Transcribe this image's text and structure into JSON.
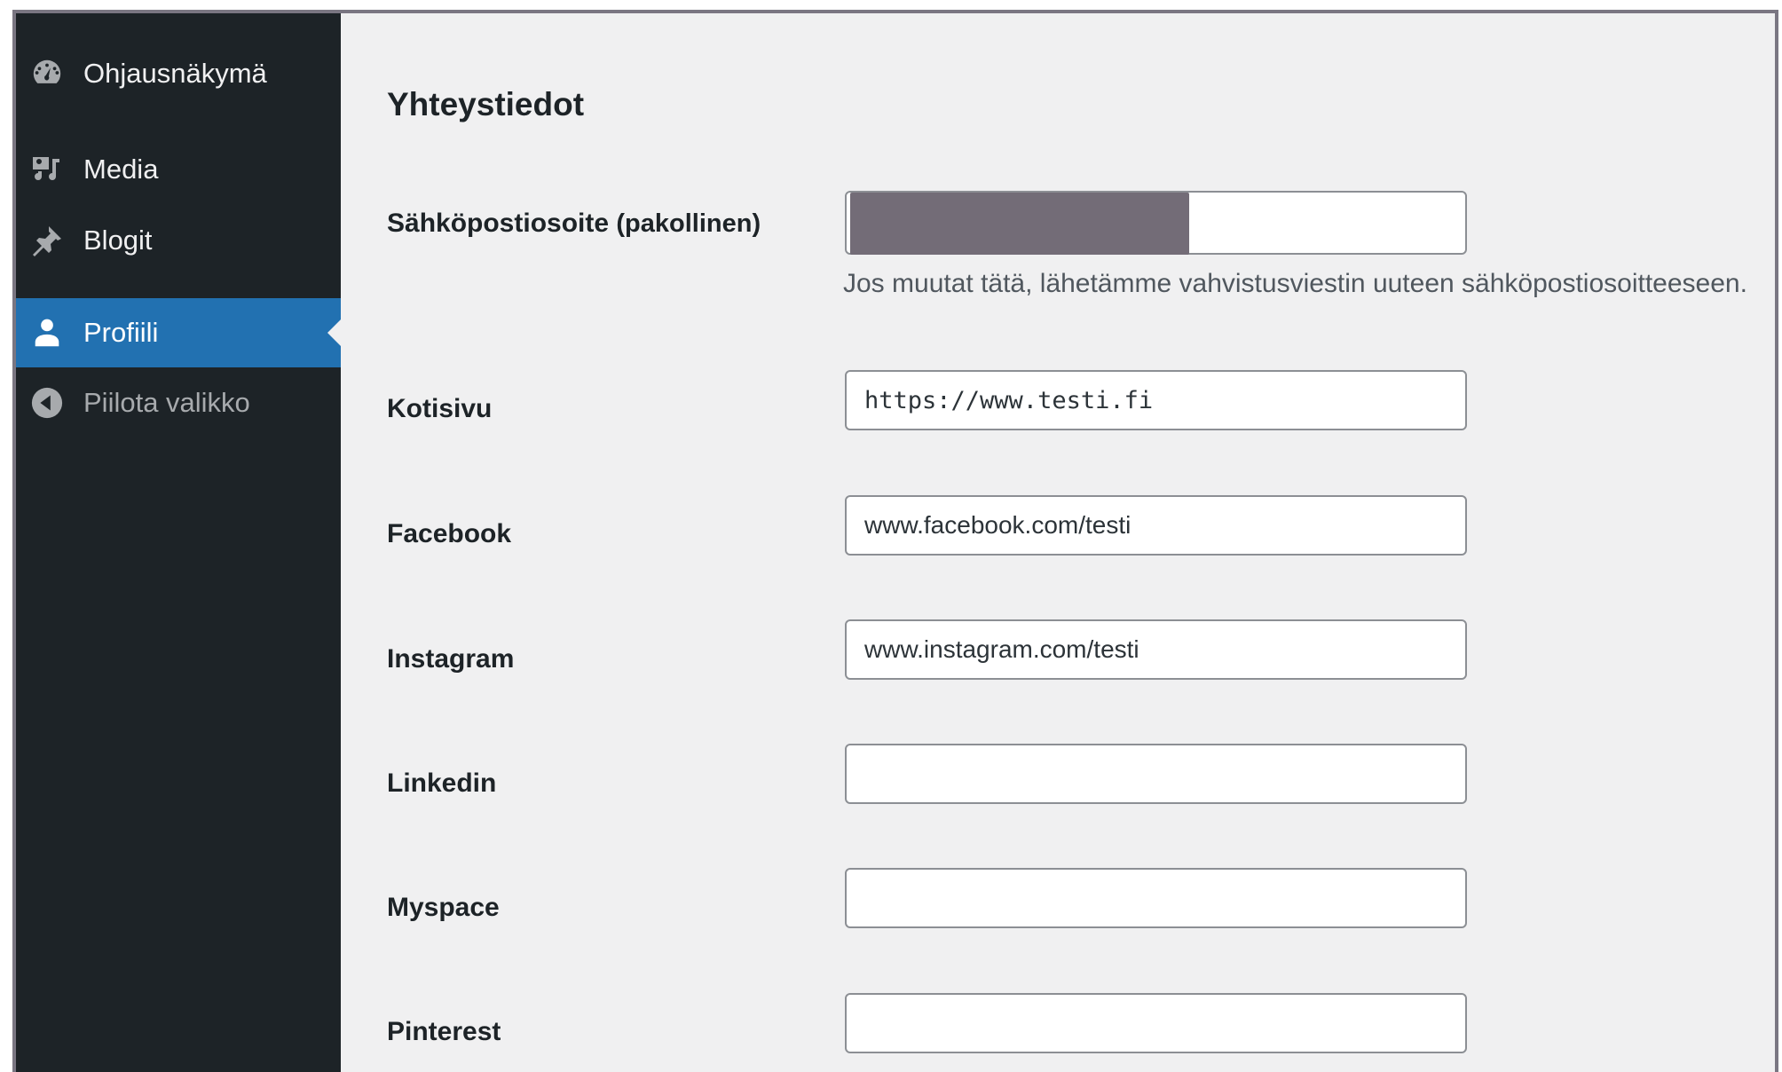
{
  "sidebar": {
    "items": [
      {
        "label": "Ohjausnäkymä",
        "icon": "dashboard-icon"
      },
      {
        "label": "Media",
        "icon": "media-icon"
      },
      {
        "label": "Blogit",
        "icon": "pushpin-icon"
      },
      {
        "label": "Profiili",
        "icon": "user-icon",
        "active": true
      },
      {
        "label": "Piilota valikko",
        "icon": "collapse-icon"
      }
    ]
  },
  "section": {
    "title": "Yhteystiedot"
  },
  "fields": {
    "email": {
      "label": "Sähköpostiosoite",
      "required": "(pakollinen)",
      "value": "",
      "description": "Jos muutat tätä, lähetämme vahvistusviestin uuteen sähköpostiosoitteeseen."
    },
    "website": {
      "label": "Kotisivu",
      "value": "https://www.testi.fi"
    },
    "facebook": {
      "label": "Facebook",
      "value": "www.facebook.com/testi"
    },
    "instagram": {
      "label": "Instagram",
      "value": "www.instagram.com/testi"
    },
    "linkedin": {
      "label": "Linkedin",
      "value": ""
    },
    "myspace": {
      "label": "Myspace",
      "value": ""
    },
    "pinterest": {
      "label": "Pinterest",
      "value": ""
    }
  },
  "colors": {
    "sidebar_bg": "#1d2327",
    "active_bg": "#2271b1",
    "content_bg": "#f0f0f1"
  }
}
